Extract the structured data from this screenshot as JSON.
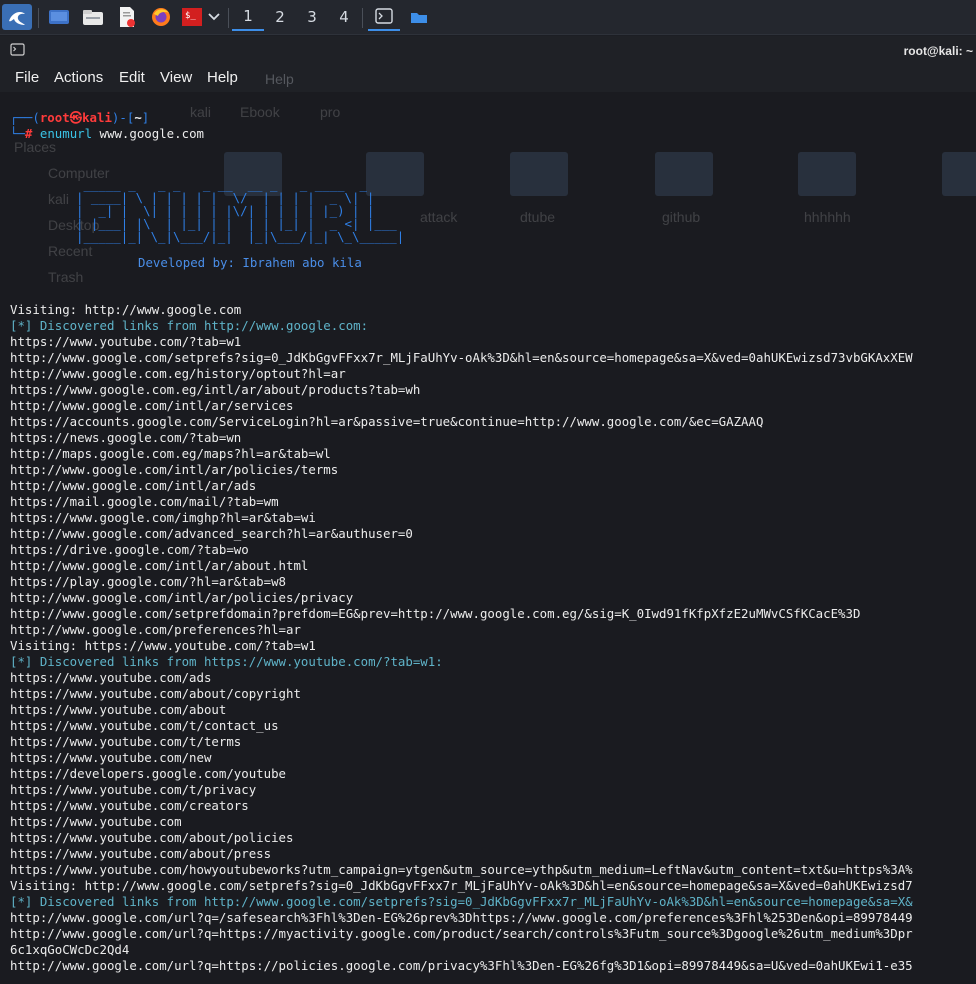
{
  "panel": {
    "icons": [
      "kali-dragon-icon",
      "show-desktop-icon",
      "file-manager-icon",
      "text-editor-icon",
      "firefox-icon",
      "terminal-emulator-icon",
      "chevron-down-icon"
    ],
    "workspaces": [
      "1",
      "2",
      "3",
      "4"
    ],
    "active_workspace": "1",
    "colors": {
      "panel_bg": "#24272e",
      "accent": "#3d8ee8"
    }
  },
  "window": {
    "title": "root@kali: ~",
    "menu": [
      "File",
      "Actions",
      "Edit",
      "View",
      "Help"
    ],
    "ghost_menu": "Help"
  },
  "ghost_file_manager": {
    "sidebar_title": "Places",
    "sidebar": [
      "Computer",
      "kali",
      "Desktop",
      "Recent",
      "Trash"
    ],
    "path": [
      "kali",
      "Ebook",
      "pro"
    ],
    "folders": [
      "attack",
      "dtube",
      "github",
      "hhhhhh"
    ]
  },
  "prompt": {
    "open": "┌──(",
    "user": "root㉿kali",
    "mid": ")-[",
    "dir": "~",
    "close": "]",
    "line2": "└─",
    "hash": "#",
    "command": "enumurl",
    "arg": "www.google.com"
  },
  "banner": {
    "art": " _____ _   _ _   _ __  __ _   _ ____  _     \n| ____| \\ | | | | |  \\/  | | | |  _ \\| |    \n|  _| |  \\| | | | | |\\/| | | | | |_) | |    \n| |___| |\\  | |_| | |  | | |_| |  _ <| |___ \n|_____|_| \\_|\\___/|_|  |_|\\___/|_| \\_\\_____|",
    "developed_by": "Developed by: Ibrahem abo kila"
  },
  "output": [
    {
      "t": "Visiting: http://www.google.com",
      "c": "white"
    },
    {
      "t": "[*] Discovered links from http://www.google.com:",
      "c": "cyan"
    },
    {
      "t": "https://www.youtube.com/?tab=w1",
      "c": "white"
    },
    {
      "t": "http://www.google.com/setprefs?sig=0_JdKbGgvFFxx7r_MLjFaUhYv-oAk%3D&hl=en&source=homepage&sa=X&ved=0ahUKEwizsd73vbGKAxXEW",
      "c": "white"
    },
    {
      "t": "http://www.google.com.eg/history/optout?hl=ar",
      "c": "white"
    },
    {
      "t": "https://www.google.com.eg/intl/ar/about/products?tab=wh",
      "c": "white"
    },
    {
      "t": "http://www.google.com/intl/ar/services",
      "c": "white"
    },
    {
      "t": "https://accounts.google.com/ServiceLogin?hl=ar&passive=true&continue=http://www.google.com/&ec=GAZAAQ",
      "c": "white"
    },
    {
      "t": "https://news.google.com/?tab=wn",
      "c": "white"
    },
    {
      "t": "http://maps.google.com.eg/maps?hl=ar&tab=wl",
      "c": "white"
    },
    {
      "t": "http://www.google.com/intl/ar/policies/terms",
      "c": "white"
    },
    {
      "t": "http://www.google.com/intl/ar/ads",
      "c": "white"
    },
    {
      "t": "https://mail.google.com/mail/?tab=wm",
      "c": "white"
    },
    {
      "t": "https://www.google.com/imghp?hl=ar&tab=wi",
      "c": "white"
    },
    {
      "t": "http://www.google.com/advanced_search?hl=ar&authuser=0",
      "c": "white"
    },
    {
      "t": "https://drive.google.com/?tab=wo",
      "c": "white"
    },
    {
      "t": "http://www.google.com/intl/ar/about.html",
      "c": "white"
    },
    {
      "t": "https://play.google.com/?hl=ar&tab=w8",
      "c": "white"
    },
    {
      "t": "http://www.google.com/intl/ar/policies/privacy",
      "c": "white"
    },
    {
      "t": "http://www.google.com/setprefdomain?prefdom=EG&prev=http://www.google.com.eg/&sig=K_0Iwd91fKfpXfzE2uMWvCSfKCacE%3D",
      "c": "white"
    },
    {
      "t": "http://www.google.com/preferences?hl=ar",
      "c": "white"
    },
    {
      "t": "Visiting: https://www.youtube.com/?tab=w1",
      "c": "white"
    },
    {
      "t": "[*] Discovered links from https://www.youtube.com/?tab=w1:",
      "c": "cyan"
    },
    {
      "t": "https://www.youtube.com/ads",
      "c": "white"
    },
    {
      "t": "https://www.youtube.com/about/copyright",
      "c": "white"
    },
    {
      "t": "https://www.youtube.com/about",
      "c": "white"
    },
    {
      "t": "https://www.youtube.com/t/contact_us",
      "c": "white"
    },
    {
      "t": "https://www.youtube.com/t/terms",
      "c": "white"
    },
    {
      "t": "https://www.youtube.com/new",
      "c": "white"
    },
    {
      "t": "https://developers.google.com/youtube",
      "c": "white"
    },
    {
      "t": "https://www.youtube.com/t/privacy",
      "c": "white"
    },
    {
      "t": "https://www.youtube.com/creators",
      "c": "white"
    },
    {
      "t": "https://www.youtube.com",
      "c": "white"
    },
    {
      "t": "https://www.youtube.com/about/policies",
      "c": "white"
    },
    {
      "t": "https://www.youtube.com/about/press",
      "c": "white"
    },
    {
      "t": "https://www.youtube.com/howyoutubeworks?utm_campaign=ytgen&utm_source=ythp&utm_medium=LeftNav&utm_content=txt&u=https%3A%",
      "c": "white"
    },
    {
      "t": "Visiting: http://www.google.com/setprefs?sig=0_JdKbGgvFFxx7r_MLjFaUhYv-oAk%3D&hl=en&source=homepage&sa=X&ved=0ahUKEwizsd7",
      "c": "white"
    },
    {
      "t": "[*] Discovered links from http://www.google.com/setprefs?sig=0_JdKbGgvFFxx7r_MLjFaUhYv-oAk%3D&hl=en&source=homepage&sa=X&",
      "c": "cyan"
    },
    {
      "t": "http://www.google.com/url?q=/safesearch%3Fhl%3Den-EG%26prev%3Dhttps://www.google.com/preferences%3Fhl%253Den&opi=89978449",
      "c": "white"
    },
    {
      "t": "http://www.google.com/url?q=https://myactivity.google.com/product/search/controls%3Futm_source%3Dgoogle%26utm_medium%3Dpr",
      "c": "white"
    },
    {
      "t": "6c1xqGoCWcDc2Qd4",
      "c": "white"
    },
    {
      "t": "http://www.google.com/url?q=https://policies.google.com/privacy%3Fhl%3Den-EG%26fg%3D1&opi=89978449&sa=U&ved=0ahUKEwi1-e35",
      "c": "white"
    }
  ]
}
